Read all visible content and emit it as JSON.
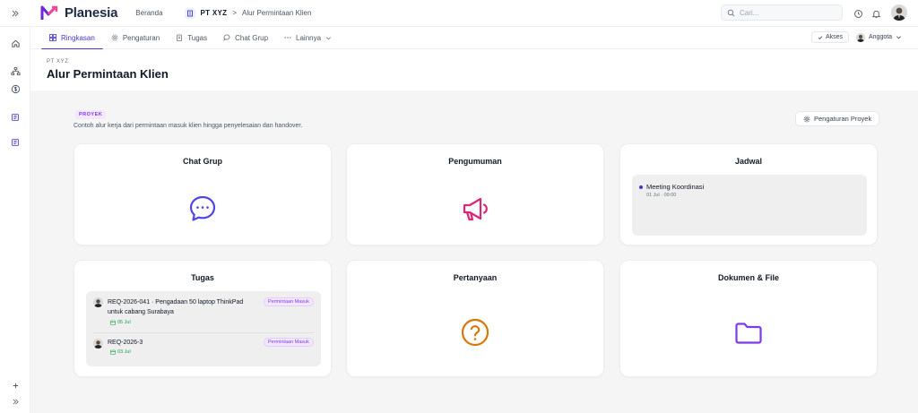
{
  "topbar": {
    "app_name": "Planesia",
    "home_link": "Beranda",
    "breadcrumb_org": "PT XYZ",
    "breadcrumb_separator": ">",
    "breadcrumb_page": "Alur Permintaan Klien",
    "search_placeholder": "Cari..."
  },
  "tabs": [
    {
      "label": "Ringkasan",
      "icon": "grid-icon",
      "active": true
    },
    {
      "label": "Pengaturan",
      "icon": "gear-icon"
    },
    {
      "label": "Tugas",
      "icon": "clipboard-icon"
    },
    {
      "label": "Chat Grup",
      "icon": "chat-icon"
    },
    {
      "label": "Lainnya",
      "icon": "more-icon"
    }
  ],
  "access_label": "Akses",
  "members_label": "Anggota",
  "page": {
    "org": "PT XYZ",
    "title": "Alur Permintaan Klien"
  },
  "project": {
    "tag": "PROYEK",
    "description": "Contoh alur kerja dari permintaan masuk klien hingga penyelesaian dan handover.",
    "settings_button": "Pengaturan Proyek"
  },
  "cards": {
    "chat": {
      "title": "Chat Grup"
    },
    "announcements": {
      "title": "Pengumuman"
    },
    "schedule": {
      "title": "Jadwal",
      "events": [
        {
          "title": "Meeting Koordinasi",
          "time": "01 Jul · 09:00"
        }
      ]
    },
    "tasks": {
      "title": "Tugas",
      "items": [
        {
          "title": "REQ-2026-041 · Pengadaan 50 laptop ThinkPad untuk cabang Surabaya",
          "badge": "Permintaan Masuk",
          "date": "05 Jul"
        },
        {
          "title": "REQ-2026-3",
          "badge": "Permintaan Masuk",
          "date": "03 Jul"
        }
      ]
    },
    "questions": {
      "title": "Pertanyaan"
    },
    "documents": {
      "title": "Dokumen & File"
    }
  },
  "colors": {
    "accent": "#4338ca",
    "chat_icon": "#4f46e5",
    "announcement_icon": "#db2777",
    "question_icon": "#d97706",
    "folder_icon": "#7c3aed",
    "badge": "#7c3aed",
    "date": "#16a34a"
  }
}
